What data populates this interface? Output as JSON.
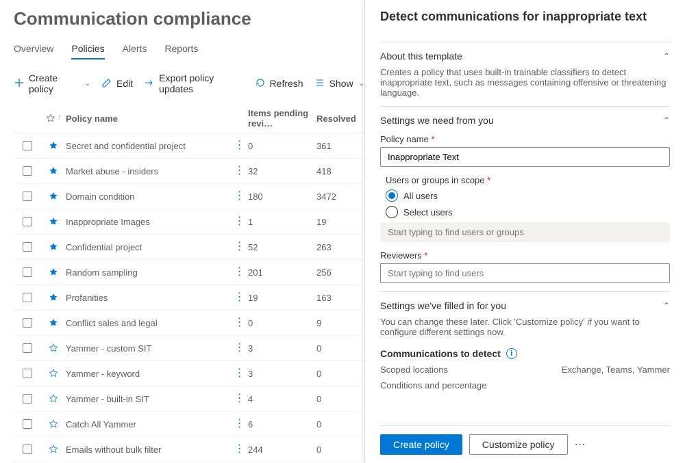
{
  "header": {
    "title": "Communication compliance"
  },
  "tabs": [
    "Overview",
    "Policies",
    "Alerts",
    "Reports"
  ],
  "activeTab": 1,
  "toolbar": {
    "create": "Create policy",
    "edit": "Edit",
    "export": "Export policy updates",
    "refresh": "Refresh",
    "show": "Show"
  },
  "columns": {
    "name": "Policy name",
    "pending": "Items pending revi…",
    "resolved": "Resolved"
  },
  "rows": [
    {
      "star": true,
      "name": "Secret and confidential project",
      "pending": "0",
      "resolved": "361"
    },
    {
      "star": true,
      "name": "Market abuse - insiders",
      "pending": "32",
      "resolved": "418"
    },
    {
      "star": true,
      "name": "Domain condition",
      "pending": "180",
      "resolved": "3472"
    },
    {
      "star": true,
      "name": "Inappropriate Images",
      "pending": "1",
      "resolved": "19"
    },
    {
      "star": true,
      "name": "Confidential project",
      "pending": "52",
      "resolved": "263"
    },
    {
      "star": true,
      "name": "Random sampling",
      "pending": "201",
      "resolved": "256"
    },
    {
      "star": true,
      "name": "Profanities",
      "pending": "19",
      "resolved": "163"
    },
    {
      "star": true,
      "name": "Conflict sales and legal",
      "pending": "0",
      "resolved": "9"
    },
    {
      "star": false,
      "name": "Yammer - custom SIT",
      "pending": "3",
      "resolved": "0"
    },
    {
      "star": false,
      "name": "Yammer - keyword",
      "pending": "3",
      "resolved": "0"
    },
    {
      "star": false,
      "name": "Yammer - built-in SIT",
      "pending": "4",
      "resolved": "0"
    },
    {
      "star": false,
      "name": "Catch All Yammer",
      "pending": "6",
      "resolved": "0"
    },
    {
      "star": false,
      "name": "Emails without bulk filter",
      "pending": "244",
      "resolved": "0"
    }
  ],
  "panel": {
    "title": "Detect communications for inappropriate text",
    "about": {
      "heading": "About this template",
      "body": "Creates a policy that uses built-in trainable classifiers to detect inappropriate text, such as messages containing offensive or threatening language."
    },
    "settings_need": {
      "heading": "Settings we need from you",
      "policy_name_label": "Policy name",
      "policy_name_value": "Inappropriate Text",
      "scope_label": "Users or groups in scope",
      "radio_all": "All users",
      "radio_select": "Select users",
      "scope_placeholder": "Start typing to find users or groups",
      "reviewers_label": "Reviewers",
      "reviewers_placeholder": "Start typing to find users"
    },
    "settings_filled": {
      "heading": "Settings we've filled in for you",
      "body": "You can change these later. Click 'Customize policy' if you want to configure different settings now.",
      "comm_heading": "Communications to detect",
      "scoped_label": "Scoped locations",
      "scoped_value": "Exchange, Teams, Yammer",
      "conditions_label": "Conditions and percentage"
    },
    "buttons": {
      "create": "Create policy",
      "customize": "Customize policy"
    }
  }
}
